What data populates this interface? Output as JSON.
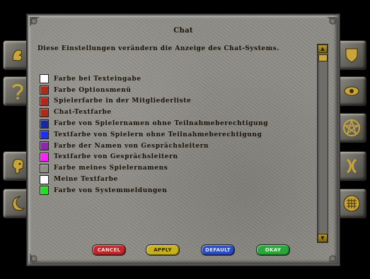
{
  "dialog": {
    "title": "Chat",
    "description": "Diese Einstellungen verändern die Anzeige des Chat-Systems."
  },
  "color_options": [
    {
      "label": "Farbe bei Texteingabe",
      "color": "#ffffff"
    },
    {
      "label": "Farbe Optionsmenü",
      "color": "#b02a1a"
    },
    {
      "label": "Spielerfarbe in der Mitgliederliste",
      "color": "#b02a1a"
    },
    {
      "label": "Chat-Textfarbe",
      "color": "#b02a1a"
    },
    {
      "label": "Farbe von Spielernamen ohne Teilnahmeberechtigung",
      "color": "#1a2a9a"
    },
    {
      "label": "Textfarbe von Spielern ohne Teilnahmeberechtigung",
      "color": "#2030e8"
    },
    {
      "label": "Farbe der Namen von Gesprächsleitern",
      "color": "#8a2aa8"
    },
    {
      "label": "Textfarbe von Gesprächsleitern",
      "color": "#ff20ff"
    },
    {
      "label": "Farbe meines Spielernamens",
      "color": "#8e8d86"
    },
    {
      "label": "Meine Textfarbe",
      "color": "#ffffff"
    },
    {
      "label": "Farbe von Systemmeldungen",
      "color": "#20e020"
    }
  ],
  "buttons": {
    "cancel": {
      "label": "CANCEL",
      "color": "#c4252a"
    },
    "apply": {
      "label": "APPLY",
      "color": "#c8b21a"
    },
    "default": {
      "label": "DEFAULT",
      "color": "#2a4ac8"
    },
    "okay": {
      "label": "OKAY",
      "color": "#28a83a"
    }
  },
  "side_icons": {
    "left": [
      "rune-b-icon",
      "rune-question-icon",
      "warrior-head-icon",
      "crescent-moon-icon"
    ],
    "right": [
      "shield-icon",
      "eye-icon",
      "pentagram-icon",
      "rune-x-icon",
      "grid-icon"
    ]
  }
}
